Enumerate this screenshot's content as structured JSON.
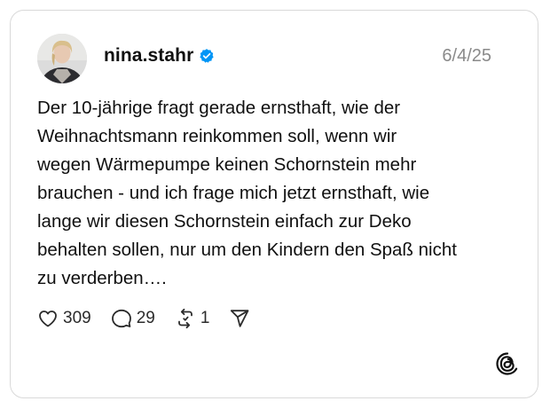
{
  "post": {
    "username": "nina.stahr",
    "verified": true,
    "date": "6/4/25",
    "text": "Der 10-jährige fragt gerade ernsthaft, wie der\nWeihnachtsmann reinkommen soll, wenn wir\nwegen Wärmepumpe keinen Schornstein mehr\nbrauchen - und ich frage mich jetzt ernsthaft, wie\nlange wir diesen Schornstein einfach zur Deko\nbehalten sollen, nur um den Kindern den Spaß nicht\nzu verderben…."
  },
  "actions": {
    "likes": "309",
    "replies": "29",
    "reposts": "1"
  },
  "icons": {
    "like": "heart-icon",
    "reply": "comment-bubble-icon",
    "repost": "repost-icon",
    "share": "send-icon",
    "verified": "verified-badge-icon",
    "brand": "threads-logo-icon"
  },
  "colors": {
    "verified_blue": "#0095f6",
    "text": "#101010",
    "muted": "#8a8a8a",
    "border": "#d9d9d9"
  }
}
